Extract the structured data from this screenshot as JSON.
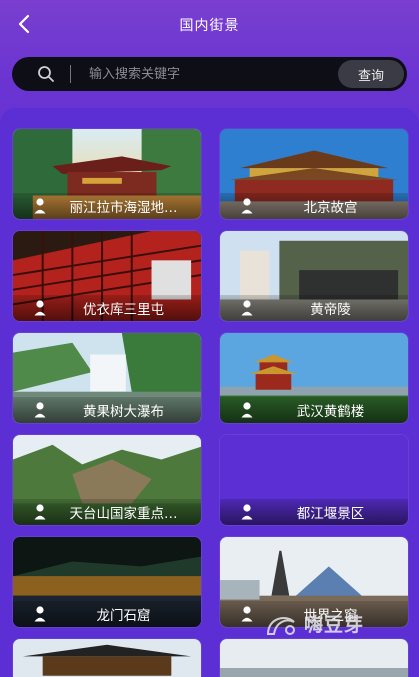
{
  "header": {
    "title": "国内街景",
    "back_icon": "chevron-left-icon"
  },
  "search": {
    "placeholder": "输入搜索关键字",
    "value": "",
    "button_label": "查询",
    "icon": "search-icon"
  },
  "spots": [
    {
      "name": "丽江拉市海湿地…"
    },
    {
      "name": "北京故宫"
    },
    {
      "name": "优衣库三里屯"
    },
    {
      "name": "黄帝陵"
    },
    {
      "name": "黄果树大瀑布"
    },
    {
      "name": "武汉黄鹤楼"
    },
    {
      "name": "天台山国家重点…"
    },
    {
      "name": "都江堰景区"
    },
    {
      "name": "龙门石窟"
    },
    {
      "name": "世界之窗"
    }
  ],
  "watermark": {
    "text": "嗨豆芽"
  },
  "colors": {
    "background": "#5b2fd3",
    "search_bg": "#0e0e16",
    "button_bg": "#3b3b45"
  }
}
